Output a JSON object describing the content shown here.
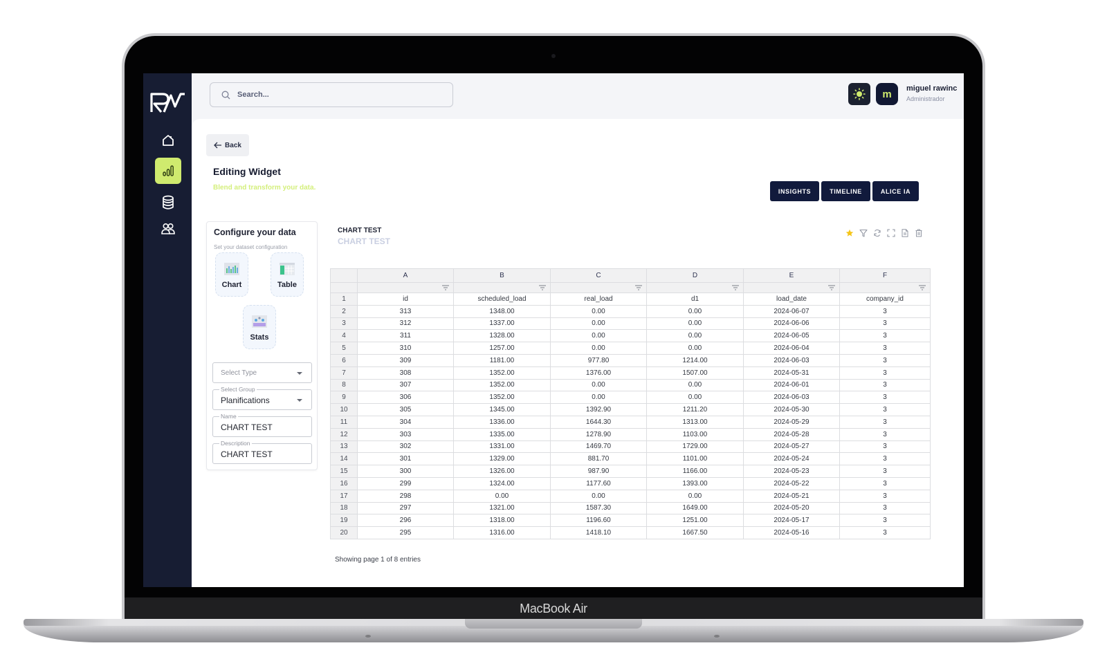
{
  "device": {
    "brand_label": "MacBook Air"
  },
  "sidebar": {
    "logo": "RW",
    "items": [
      {
        "name": "home",
        "icon": "home-icon",
        "active": false
      },
      {
        "name": "charts",
        "icon": "bar-chart-icon",
        "active": true
      },
      {
        "name": "database",
        "icon": "database-icon",
        "active": false
      },
      {
        "name": "users",
        "icon": "users-icon",
        "active": false
      }
    ]
  },
  "topbar": {
    "search_placeholder": "Search...",
    "theme_icon": "sun-icon",
    "user": {
      "avatar_initial": "m",
      "name": "miguel rawinc",
      "role": "Administrador"
    }
  },
  "page": {
    "back_label": "Back",
    "title": "Editing Widget",
    "subtitle": "Blend and transform your data.",
    "actions": [
      "INSIGHTS",
      "TIMELINE",
      "ALICE IA"
    ]
  },
  "config": {
    "title": "Configure your data",
    "subtitle": "Set your dataset configuration",
    "types": [
      {
        "label": "Chart",
        "icon": "chart-thumb-icon"
      },
      {
        "label": "Table",
        "icon": "table-thumb-icon"
      },
      {
        "label": "Stats",
        "icon": "stats-thumb-icon"
      }
    ],
    "fields": {
      "type": {
        "placeholder": "Select Type",
        "value": ""
      },
      "group": {
        "label": "Select Group",
        "value": "Planifications"
      },
      "name": {
        "label": "Name",
        "value": "CHART TEST"
      },
      "description": {
        "label": "Description",
        "value": "CHART TEST"
      }
    }
  },
  "widget": {
    "title": "CHART TEST",
    "description": "CHART TEST",
    "tools": [
      "star-icon",
      "filter-icon",
      "refresh-icon",
      "fullscreen-icon",
      "document-icon",
      "trash-icon"
    ],
    "accent_star": "#f5c518"
  },
  "grid": {
    "column_letters": [
      "A",
      "B",
      "C",
      "D",
      "E",
      "F"
    ],
    "header_row_number": "1",
    "field_names": [
      "id",
      "scheduled_load",
      "real_load",
      "d1",
      "load_date",
      "company_id"
    ],
    "rows": [
      [
        "2",
        "313",
        "1348.00",
        "0.00",
        "0.00",
        "2024-06-07",
        "3"
      ],
      [
        "3",
        "312",
        "1337.00",
        "0.00",
        "0.00",
        "2024-06-06",
        "3"
      ],
      [
        "4",
        "311",
        "1328.00",
        "0.00",
        "0.00",
        "2024-06-05",
        "3"
      ],
      [
        "5",
        "310",
        "1257.00",
        "0.00",
        "0.00",
        "2024-06-04",
        "3"
      ],
      [
        "6",
        "309",
        "1181.00",
        "977.80",
        "1214.00",
        "2024-06-03",
        "3"
      ],
      [
        "7",
        "308",
        "1352.00",
        "1376.00",
        "1507.00",
        "2024-05-31",
        "3"
      ],
      [
        "8",
        "307",
        "1352.00",
        "0.00",
        "0.00",
        "2024-06-01",
        "3"
      ],
      [
        "9",
        "306",
        "1352.00",
        "0.00",
        "0.00",
        "2024-06-03",
        "3"
      ],
      [
        "10",
        "305",
        "1345.00",
        "1392.90",
        "1211.20",
        "2024-05-30",
        "3"
      ],
      [
        "11",
        "304",
        "1336.00",
        "1644.30",
        "1313.00",
        "2024-05-29",
        "3"
      ],
      [
        "12",
        "303",
        "1335.00",
        "1278.90",
        "1103.00",
        "2024-05-28",
        "3"
      ],
      [
        "13",
        "302",
        "1331.00",
        "1469.70",
        "1729.00",
        "2024-05-27",
        "3"
      ],
      [
        "14",
        "301",
        "1329.00",
        "881.70",
        "1101.00",
        "2024-05-24",
        "3"
      ],
      [
        "15",
        "300",
        "1326.00",
        "987.90",
        "1166.00",
        "2024-05-23",
        "3"
      ],
      [
        "16",
        "299",
        "1324.00",
        "1177.60",
        "1393.00",
        "2024-05-22",
        "3"
      ],
      [
        "17",
        "298",
        "0.00",
        "0.00",
        "0.00",
        "2024-05-21",
        "3"
      ],
      [
        "18",
        "297",
        "1321.00",
        "1587.30",
        "1649.00",
        "2024-05-20",
        "3"
      ],
      [
        "19",
        "296",
        "1318.00",
        "1196.60",
        "1251.00",
        "2024-05-17",
        "3"
      ],
      [
        "20",
        "295",
        "1316.00",
        "1418.10",
        "1667.50",
        "2024-05-16",
        "3"
      ]
    ],
    "footer": "Showing page 1 of 8 entries"
  },
  "colors": {
    "sidebar_bg": "#171d33",
    "accent_lime": "#cfea6e",
    "button_navy": "#111a3c"
  }
}
